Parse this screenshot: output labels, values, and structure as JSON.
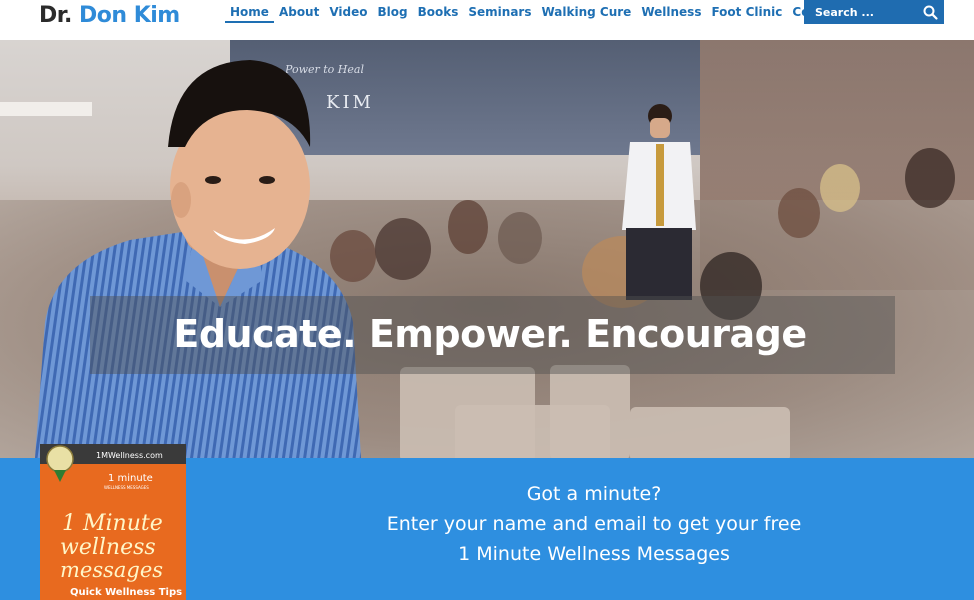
{
  "header": {
    "logo": {
      "prefix": "Dr.",
      "name": "Don Kim"
    },
    "nav": [
      "Home",
      "About",
      "Video",
      "Blog",
      "Books",
      "Seminars",
      "Walking Cure",
      "Wellness",
      "Foot Clinic",
      "Contact"
    ],
    "active_nav": "Home",
    "search": {
      "placeholder": "Search ..."
    }
  },
  "hero": {
    "screen_subtitle": "Power to Heal",
    "screen_name": "KIM",
    "tagline": "Educate. Empower. Encourage"
  },
  "signup": {
    "line1": "Got a minute?",
    "line2": "Enter your name and email to get your free",
    "line3": "1 Minute Wellness Messages"
  },
  "book": {
    "site": "1MWellness.com",
    "badge_line": "1 minute",
    "badge_sub": "WELLNESS MESSAGES",
    "title1": "1 Minute",
    "title2": "wellness",
    "title3": "messages",
    "tagline": "Quick Wellness Tips"
  },
  "colors": {
    "brand_blue": "#2f8bd8",
    "nav_blue": "#1e6fb3",
    "signup_blue": "#2e8fe0",
    "search_bg": "#1f6cb0"
  }
}
